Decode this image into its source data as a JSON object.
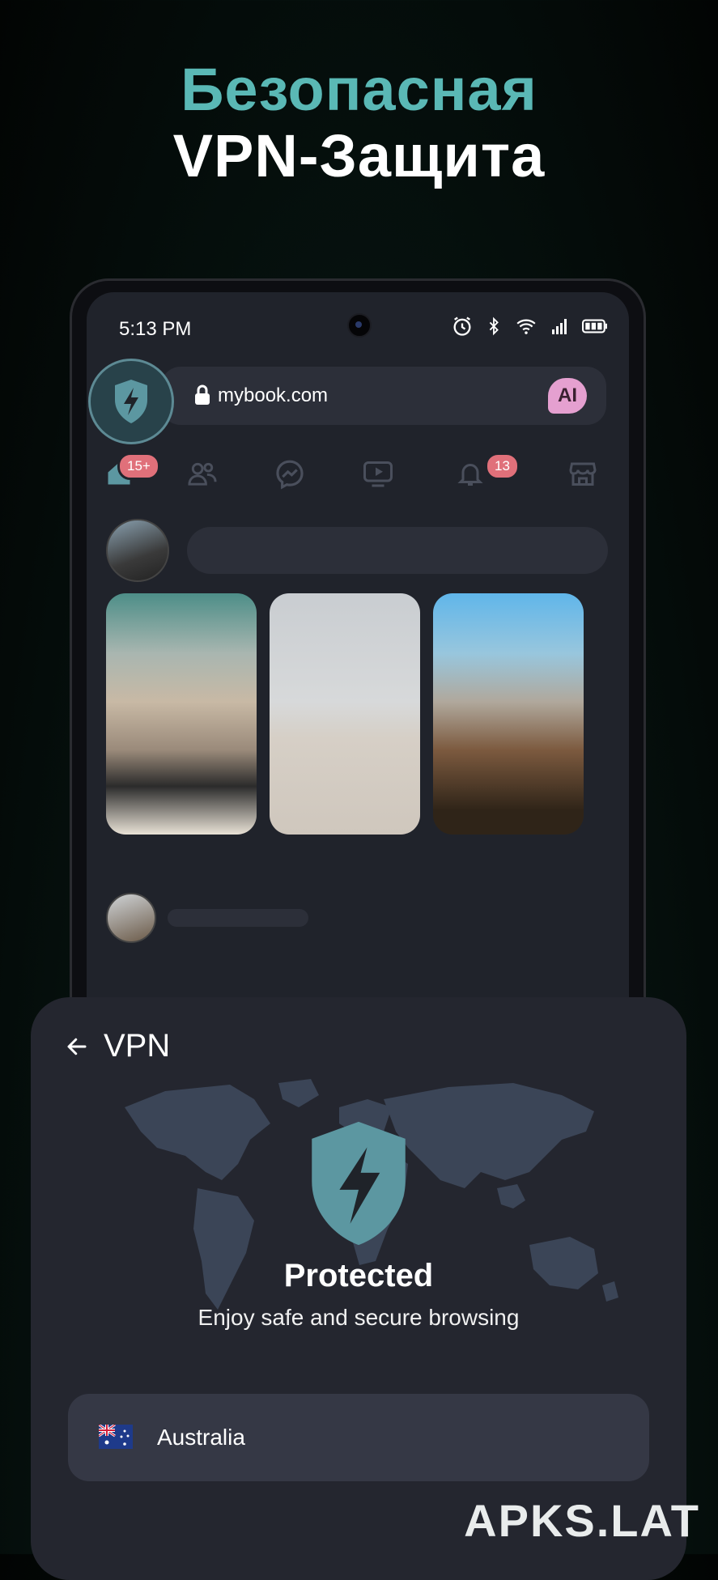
{
  "promo": {
    "line1": "Безопасная",
    "line2": "VPN-Защита",
    "accent_color": "#5ab8b5"
  },
  "status_bar": {
    "time": "5:13 PM",
    "icons": [
      "alarm-icon",
      "bluetooth-icon",
      "wifi-icon",
      "signal-icon",
      "battery-icon"
    ]
  },
  "browser": {
    "url": "mybook.com",
    "ai_label": "AI"
  },
  "nav": {
    "items": [
      {
        "name": "home",
        "icon": "home-icon",
        "badge": "15+"
      },
      {
        "name": "friends",
        "icon": "friends-icon",
        "badge": ""
      },
      {
        "name": "messenger",
        "icon": "messenger-icon",
        "badge": ""
      },
      {
        "name": "video",
        "icon": "video-icon",
        "badge": ""
      },
      {
        "name": "notifications",
        "icon": "bell-icon",
        "badge": "13"
      },
      {
        "name": "marketplace",
        "icon": "store-icon",
        "badge": ""
      }
    ],
    "badge_color": "#e0707a"
  },
  "vpn": {
    "title": "VPN",
    "status": "Protected",
    "subtitle": "Enjoy safe and secure browsing",
    "country": "Australia",
    "shield_color": "#5c97a1"
  },
  "watermark": "APKS.LAT"
}
